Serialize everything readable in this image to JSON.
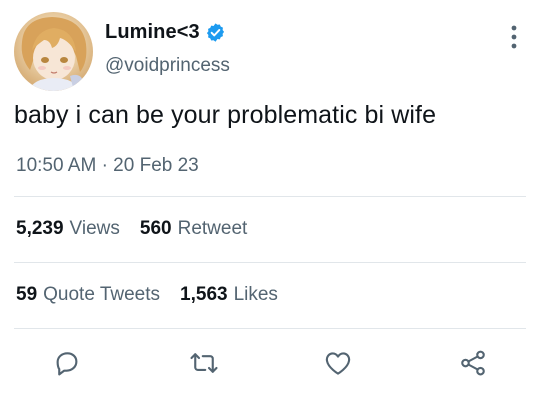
{
  "user": {
    "display_name": "Lumine<3",
    "handle": "@voidprincess",
    "verified": true
  },
  "tweet": {
    "text": "baby i can be your problematic bi wife",
    "time": "10:50 AM",
    "separator": "·",
    "date": "20 Feb 23"
  },
  "stats": {
    "views_count": "5,239",
    "views_label": "Views",
    "retweets_count": "560",
    "retweets_label": "Retweet",
    "quote_count": "59",
    "quote_label": "Quote Tweets",
    "likes_count": "1,563",
    "likes_label": "Likes"
  },
  "actions": [
    "reply-icon",
    "retweet-icon",
    "like-icon",
    "share-icon"
  ],
  "colors": {
    "verified": "#1d9bf0",
    "secondary_text": "#536471",
    "primary_text": "#0f1419",
    "divider": "#e1e6ea"
  }
}
